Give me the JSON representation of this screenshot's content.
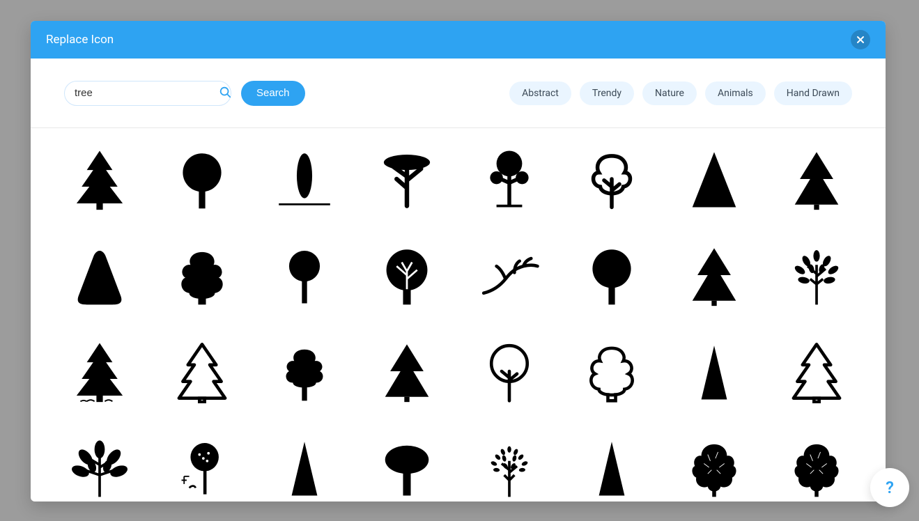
{
  "modal": {
    "title": "Replace Icon"
  },
  "search": {
    "value": "tree",
    "placeholder": "",
    "button_label": "Search"
  },
  "categories": [
    "Abstract",
    "Trendy",
    "Nature",
    "Animals",
    "Hand Drawn"
  ],
  "help": {
    "label": "?"
  },
  "icons": [
    {
      "name": "pine-tree-icon",
      "style": "solid"
    },
    {
      "name": "round-tree-stem-icon",
      "style": "solid"
    },
    {
      "name": "cypress-tree-icon",
      "style": "solid"
    },
    {
      "name": "savanna-tree-icon",
      "style": "solid"
    },
    {
      "name": "bonsai-tree-icon",
      "style": "solid"
    },
    {
      "name": "round-tree-outline-icon",
      "style": "outline"
    },
    {
      "name": "triangle-tree-icon",
      "style": "solid"
    },
    {
      "name": "fir-tree-icon",
      "style": "solid"
    },
    {
      "name": "rounded-triangle-tree-icon",
      "style": "solid"
    },
    {
      "name": "bushy-tree-icon",
      "style": "solid"
    },
    {
      "name": "lollipop-tree-icon",
      "style": "solid"
    },
    {
      "name": "detailed-round-tree-icon",
      "style": "solid"
    },
    {
      "name": "bare-branch-icon",
      "style": "solid"
    },
    {
      "name": "simple-round-tree-icon",
      "style": "solid"
    },
    {
      "name": "spruce-tree-icon",
      "style": "solid"
    },
    {
      "name": "leafy-tree-icon",
      "style": "solid"
    },
    {
      "name": "pine-with-roots-icon",
      "style": "solid"
    },
    {
      "name": "christmas-tree-outline-icon",
      "style": "outline"
    },
    {
      "name": "cloud-tree-icon",
      "style": "solid"
    },
    {
      "name": "evergreen-tree-icon",
      "style": "solid"
    },
    {
      "name": "apple-tree-outline-icon",
      "style": "outline"
    },
    {
      "name": "oak-tree-outline-icon",
      "style": "outline"
    },
    {
      "name": "narrow-tree-icon",
      "style": "solid"
    },
    {
      "name": "fir-tree-outline-icon",
      "style": "outline"
    },
    {
      "name": "branch-with-leaves-icon",
      "style": "solid"
    },
    {
      "name": "music-tree-icon",
      "style": "solid"
    },
    {
      "name": "simple-pine-icon",
      "style": "solid"
    },
    {
      "name": "broad-tree-icon",
      "style": "solid"
    },
    {
      "name": "dotted-leaves-tree-icon",
      "style": "solid"
    },
    {
      "name": "tall-triangle-tree-icon",
      "style": "solid"
    },
    {
      "name": "realistic-tree-icon",
      "style": "solid"
    },
    {
      "name": "textured-tree-icon",
      "style": "solid"
    }
  ]
}
